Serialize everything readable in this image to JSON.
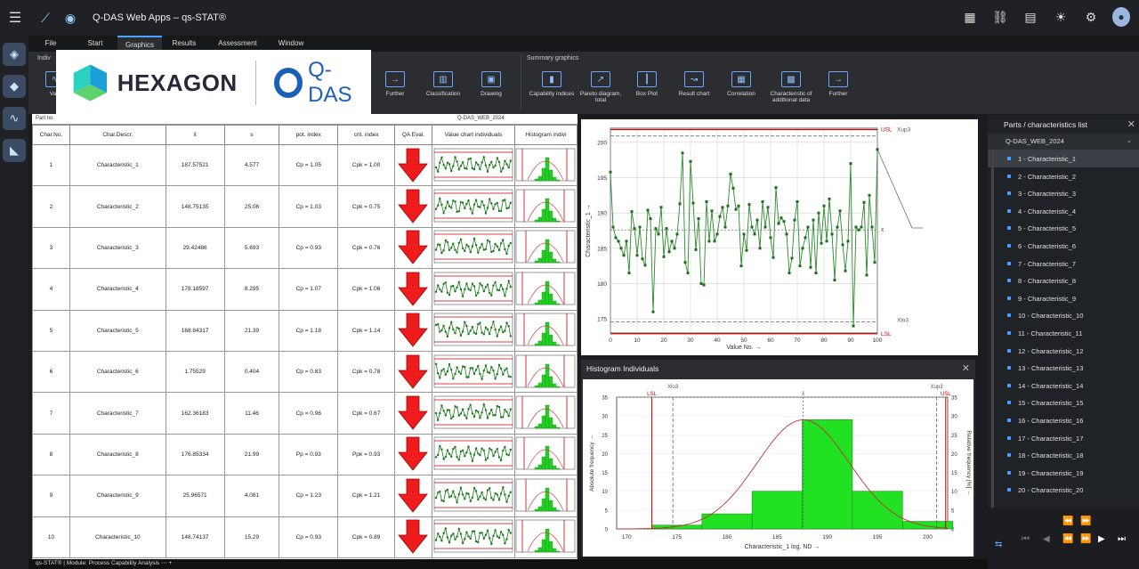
{
  "app": {
    "title": "Q-DAS Web Apps – qs-STAT®"
  },
  "menu": [
    "File",
    "Start",
    "Graphics",
    "Results",
    "Assessment",
    "Window"
  ],
  "ribbon": {
    "group_left": "Indiv",
    "group_summary": "Summary graphics",
    "buttons_left": [
      "Valu",
      "Further",
      "Classification",
      "Drawing"
    ],
    "buttons_summary": [
      "Capability indices",
      "Pareto diagram, total",
      "Box Plot",
      "Result chart",
      "Correlation",
      "Characteristic of additional data",
      "Further"
    ]
  },
  "brand": {
    "hexagon": "HEXAGON",
    "qdas": "Q-DAS"
  },
  "table": {
    "top_labels": [
      "Part no.",
      "Q-DAS_WEB_2024"
    ],
    "headers": [
      "Char.No.",
      "Char.Descr.",
      "x̄",
      "s",
      "pot. index",
      "crit. index",
      "QA Eval.",
      "Value chart individuals",
      "Histogram indivi"
    ],
    "rows": [
      {
        "no": "1",
        "descr": "Characteristic_1",
        "xbar": "187.57521",
        "s": "4.577",
        "pot": "Cp = 1.05",
        "crit": "Cpk = 1.00"
      },
      {
        "no": "2",
        "descr": "Characteristic_2",
        "xbar": "148.75135",
        "s": "25.06",
        "pot": "Cp = 1.03",
        "crit": "Cpk = 0.75"
      },
      {
        "no": "3",
        "descr": "Characteristic_3",
        "xbar": "29.42486",
        "s": "5.693",
        "pot": "Cp = 0.93",
        "crit": "Cpk = 0.76"
      },
      {
        "no": "4",
        "descr": "Characteristic_4",
        "xbar": "178.18597",
        "s": "8.295",
        "pot": "Cp = 1.07",
        "crit": "Cpk = 1.06"
      },
      {
        "no": "5",
        "descr": "Characteristic_5",
        "xbar": "168.84317",
        "s": "21.39",
        "pot": "Cp = 1.18",
        "crit": "Cpk = 1.14"
      },
      {
        "no": "6",
        "descr": "Characteristic_6",
        "xbar": "1.75529",
        "s": "0.404",
        "pot": "Cp = 0.83",
        "crit": "Cpk = 0.78"
      },
      {
        "no": "7",
        "descr": "Characteristic_7",
        "xbar": "162.36183",
        "s": "11.46",
        "pot": "Cp = 0.96",
        "crit": "Cpk = 0.67"
      },
      {
        "no": "8",
        "descr": "Characteristic_8",
        "xbar": "176.85334",
        "s": "21.99",
        "pot": "Pp = 0.93",
        "crit": "Ppk = 0.93"
      },
      {
        "no": "9",
        "descr": "Characteristic_9",
        "xbar": "25.96571",
        "s": "4.081",
        "pot": "Cp = 1.23",
        "crit": "Cpk = 1.21"
      },
      {
        "no": "10",
        "descr": "Characteristic_10",
        "xbar": "148.74137",
        "s": "15.29",
        "pot": "Cp = 0.93",
        "crit": "Cpk = 0.89"
      }
    ]
  },
  "value_chart": {
    "ylabel": "Characteristic_1 →",
    "xlabel": "Value No. →",
    "usl_label": "USL",
    "lsl_label": "LSL",
    "xbar_label": "x̄",
    "xup_label": "Xup3",
    "xlo_label": "Xlo3",
    "yticks": [
      "175",
      "180",
      "185",
      "190",
      "195",
      "200"
    ],
    "xticks": [
      "0",
      "10",
      "20",
      "30",
      "40",
      "50",
      "60",
      "70",
      "80",
      "90",
      "100"
    ]
  },
  "histogram": {
    "title": "Histogram Individuals",
    "xlabel": "Characteristic_1  log. ND →",
    "ylabel": "Absolute frequency →",
    "ylabel_right": "Relative frequency [%] →",
    "lsl_label": "LSL",
    "usl_label": "USL",
    "xlo_label": "Xlo3",
    "xup_label": "Xup3",
    "xbar_label": "x̄",
    "xticks": [
      "170",
      "175",
      "180",
      "185",
      "190",
      "195",
      "200"
    ],
    "yticks": [
      "0",
      "5",
      "10",
      "15",
      "20",
      "25",
      "30",
      "35"
    ]
  },
  "chart_data": [
    {
      "type": "line",
      "title": "",
      "xlabel": "Value No. →",
      "ylabel": "Characteristic_1 →",
      "xlim": [
        0,
        100
      ],
      "ylim": [
        173,
        202
      ],
      "usl": 201.8,
      "lsl": 172.9,
      "mean": 187.6,
      "y": [
        195.8,
        188,
        186.5,
        186,
        185,
        184,
        186,
        181.5,
        190.2,
        187.8,
        184,
        188,
        183.5,
        182.6,
        190.4,
        189.2,
        176,
        187.8,
        187,
        190.8,
        183.8,
        187.8,
        184.5,
        186,
        185,
        187,
        191.3,
        198.5,
        183,
        181.5,
        197.3,
        191.4,
        184.8,
        189.2,
        180,
        179.8,
        191.6,
        186,
        190.3,
        186,
        187,
        189.5,
        190.8,
        188,
        191,
        195.5,
        193.5,
        190.5,
        191,
        182.5,
        187,
        184.7,
        191.2,
        188,
        187,
        189,
        185,
        191.6,
        188,
        190.8,
        186.5,
        183.7,
        193.6,
        188.5,
        189.3,
        188.8,
        187,
        181.5,
        183.6,
        189,
        191.6,
        182.5,
        185,
        186.5,
        188,
        182.3,
        189,
        181.5,
        190,
        185.7,
        191,
        186,
        192,
        187,
        180.5,
        188,
        190.3,
        185.5,
        181.8,
        186,
        197,
        174,
        188,
        187.6,
        188,
        191.5,
        181.2,
        192.5,
        188,
        183,
        199
      ]
    },
    {
      "type": "bar",
      "title": "Histogram Individuals",
      "xlabel": "Characteristic_1  log. ND →",
      "ylabel": "Absolute frequency →",
      "categories": [
        "172.5-177.5",
        "177.5-182.5",
        "182.5-187.5",
        "187.5-192.5",
        "192.5-197.5",
        "197.5-202.5"
      ],
      "bins": [
        [
          172.5,
          177.5
        ],
        [
          177.5,
          182.5
        ],
        [
          182.5,
          187.5
        ],
        [
          187.5,
          192.5
        ],
        [
          192.5,
          197.5
        ],
        [
          197.5,
          202.5
        ]
      ],
      "values": [
        1,
        4,
        10,
        29,
        10,
        2
      ],
      "ylim": [
        0,
        35
      ],
      "xlim": [
        169,
        202
      ]
    }
  ],
  "right_panel": {
    "title": "Parts / characteristics list",
    "root": "Q-DAS_WEB_2024",
    "items": [
      "1 - Characteristic_1",
      "2 - Characteristic_2",
      "3 - Characteristic_3",
      "4 - Characteristic_4",
      "5 - Characteristic_5",
      "6 - Characteristic_6",
      "7 - Characteristic_7",
      "8 - Characteristic_8",
      "9 - Characteristic_9",
      "10 - Characteristic_10",
      "11 - Characteristic_11",
      "12 - Characteristic_12",
      "13 - Characteristic_13",
      "14 - Characteristic_14",
      "15 - Characteristic_15",
      "16 - Characteristic_16",
      "17 - Characteristic_17",
      "18 - Characteristic_18",
      "19 - Characteristic_19",
      "20 - Characteristic_20"
    ]
  },
  "status": {
    "text": "qs-STAT® | Module: Process Capability Analysis"
  }
}
